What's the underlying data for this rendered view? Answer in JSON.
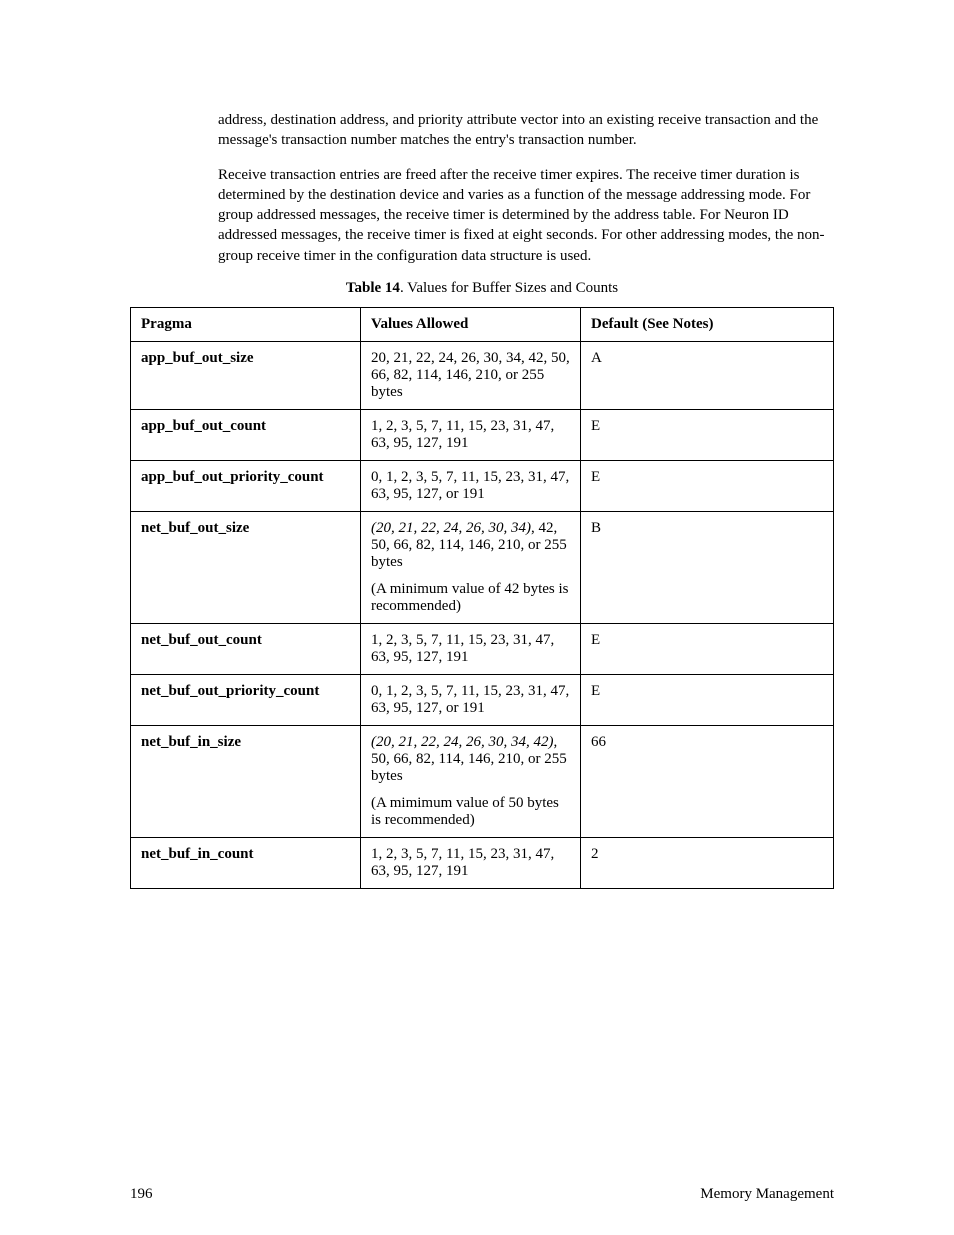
{
  "paragraphs": {
    "p1": "address, destination address, and priority attribute vector into an existing receive transaction and the message's transaction number matches the entry's transaction number.",
    "p2": "Receive transaction entries are freed after the receive timer expires.  The receive timer duration is determined by the destination device and varies as a function of the message addressing mode.  For group addressed messages, the receive timer is determined by the address table.  For Neuron ID addressed messages, the receive timer is fixed at eight seconds.  For other addressing modes, the non-group receive timer in the configuration data structure is used."
  },
  "caption": {
    "label": "Table 14",
    "rest": ". Values for Buffer Sizes and Counts"
  },
  "table": {
    "headers": {
      "c1": "Pragma",
      "c2": "Values Allowed",
      "c3": "Default (See Notes)"
    },
    "rows": [
      {
        "pragma": "app_buf_out_size",
        "values": "20, 21, 22, 24, 26, 30, 34, 42, 50, 66, 82, 114, 146,  210, or 255 bytes",
        "default": "A"
      },
      {
        "pragma": "app_buf_out_count",
        "values": "1, 2, 3, 5, 7, 11, 15, 23, 31, 47, 63, 95, 127, 191",
        "default": "E"
      },
      {
        "pragma": "app_buf_out_priority_count",
        "values": "0, 1, 2, 3, 5, 7, 11, 15, 23, 31, 47, 63, 95, 127, or 191",
        "default": "E"
      },
      {
        "pragma": "net_buf_out_size",
        "values_italic": "(20, 21, 22, 24, 26, 30, 34)",
        "values_rest": ", 42, 50, 66, 82, 114, 146,  210, or 255 bytes",
        "values_note": "(A minimum value of 42 bytes is recommended)",
        "default": "B"
      },
      {
        "pragma": "net_buf_out_count",
        "values": "1, 2, 3, 5, 7, 11, 15, 23, 31, 47, 63, 95, 127, 191",
        "default": "E"
      },
      {
        "pragma": "net_buf_out_priority_count",
        "values": "0, 1, 2, 3, 5, 7, 11, 15, 23, 31, 47, 63, 95, 127, or 191",
        "default": "E"
      },
      {
        "pragma": "net_buf_in_size",
        "values_italic": "(20, 21, 22, 24, 26, 30, 34, 42)",
        "values_rest": ", 50, 66, 82, 114, 146,  210, or 255 bytes",
        "values_note": "(A mimimum value of 50 bytes is recommended)",
        "default": "66"
      },
      {
        "pragma": "net_buf_in_count",
        "values": "1, 2, 3, 5, 7, 11, 15, 23, 31, 47, 63, 95, 127, 191",
        "default": "2"
      }
    ]
  },
  "footer": {
    "page": "196",
    "section": "Memory Management"
  }
}
